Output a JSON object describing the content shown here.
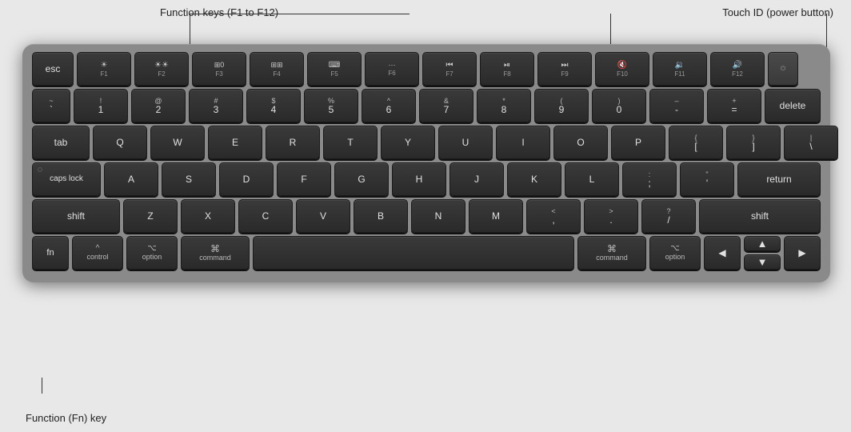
{
  "annotations": {
    "function_keys_label": "Function keys (F1 to F12)",
    "touch_id_label": "Touch ID (power button)",
    "fn_key_label": "Function (Fn) key"
  },
  "keyboard": {
    "rows": {
      "frow": [
        "esc",
        "F1",
        "F2",
        "F3",
        "F4",
        "F5",
        "F6",
        "F7",
        "F8",
        "F9",
        "F10",
        "F11",
        "F12",
        "TouchID"
      ],
      "row1": [
        "~`",
        "!1",
        "@2",
        "#3",
        "$4",
        "%5",
        "^6",
        "&7",
        "*8",
        "(9",
        ")0",
        "-",
        "=",
        "delete"
      ],
      "row2": [
        "tab",
        "Q",
        "W",
        "E",
        "R",
        "T",
        "Y",
        "U",
        "I",
        "O",
        "P",
        "{[",
        "}\\ ]",
        "|\\"
      ],
      "row3": [
        "caps lock",
        "A",
        "S",
        "D",
        "F",
        "G",
        "H",
        "J",
        "K",
        "L",
        ";:",
        "'\"",
        "return"
      ],
      "row4": [
        "shift",
        "Z",
        "X",
        "C",
        "V",
        "B",
        "N",
        "M",
        "<,",
        ">.",
        "?/",
        "shift"
      ],
      "row5": [
        "fn",
        "control",
        "option",
        "command",
        "space",
        "command",
        "option",
        "←",
        "↑↓",
        "→"
      ]
    }
  }
}
